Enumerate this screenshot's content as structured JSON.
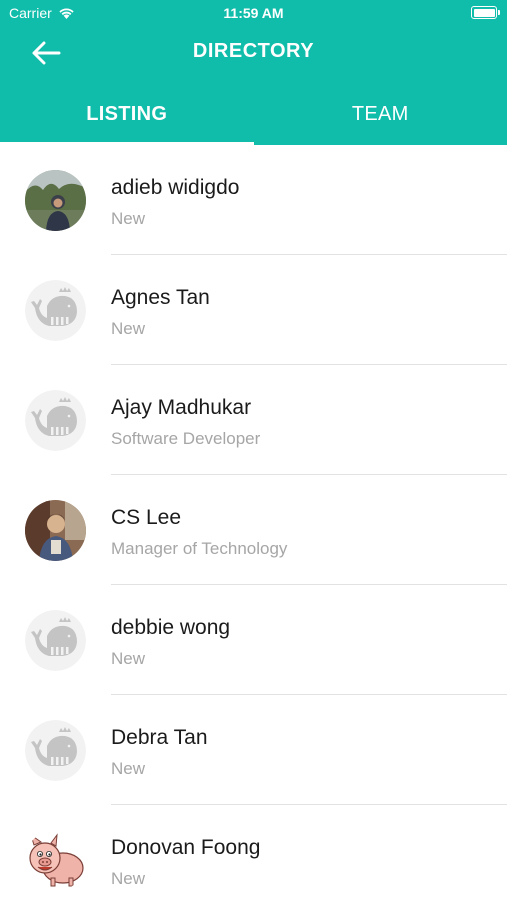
{
  "status_bar": {
    "carrier": "Carrier",
    "time": "11:59 AM"
  },
  "nav": {
    "title": "DIRECTORY"
  },
  "tabs": [
    {
      "label": "LISTING",
      "active": true
    },
    {
      "label": "TEAM",
      "active": false
    }
  ],
  "contacts": [
    {
      "name": "adieb widigdo",
      "subtitle": "New",
      "avatar": "photo-outdoor"
    },
    {
      "name": "Agnes Tan",
      "subtitle": "New",
      "avatar": "placeholder-whale"
    },
    {
      "name": "Ajay Madhukar",
      "subtitle": "Software Developer",
      "avatar": "placeholder-whale"
    },
    {
      "name": "CS Lee",
      "subtitle": "Manager of Technology",
      "avatar": "photo-portrait"
    },
    {
      "name": "debbie wong",
      "subtitle": "New",
      "avatar": "placeholder-whale"
    },
    {
      "name": "Debra Tan",
      "subtitle": "New",
      "avatar": "placeholder-whale"
    },
    {
      "name": "Donovan Foong",
      "subtitle": "New",
      "avatar": "cartoon-pig"
    }
  ],
  "colors": {
    "header": "#10bcaa",
    "name": "#1b1b1b",
    "subtitle": "#a6a6a6",
    "divider": "#e2e2e2"
  }
}
